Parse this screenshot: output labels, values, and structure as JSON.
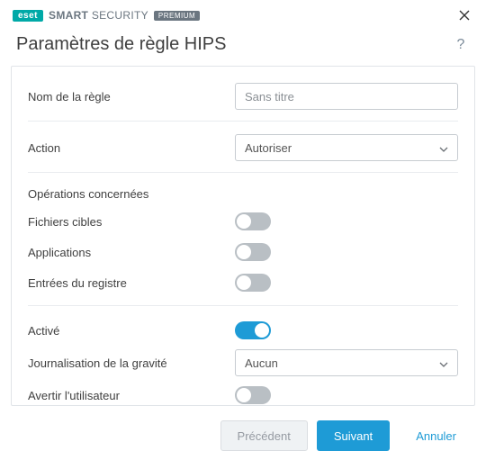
{
  "brand": {
    "eset": "eset",
    "smart": "SMART",
    "security": "SECURITY",
    "premium": "PREMIUM"
  },
  "header": {
    "title": "Paramètres de règle HIPS"
  },
  "fields": {
    "rule_name_label": "Nom de la règle",
    "rule_name_placeholder": "Sans titre",
    "rule_name_value": "",
    "action_label": "Action",
    "action_value": "Autoriser",
    "operations_concerned": "Opérations concernées",
    "target_files_label": "Fichiers cibles",
    "target_files_on": false,
    "applications_label": "Applications",
    "applications_on": false,
    "registry_entries_label": "Entrées du registre",
    "registry_entries_on": false,
    "enabled_label": "Activé",
    "enabled_on": true,
    "logging_severity_label": "Journalisation de la gravité",
    "logging_severity_value": "Aucun",
    "notify_user_label": "Avertir l'utilisateur",
    "notify_user_on": false
  },
  "footer": {
    "previous": "Précédent",
    "next": "Suivant",
    "cancel": "Annuler"
  }
}
